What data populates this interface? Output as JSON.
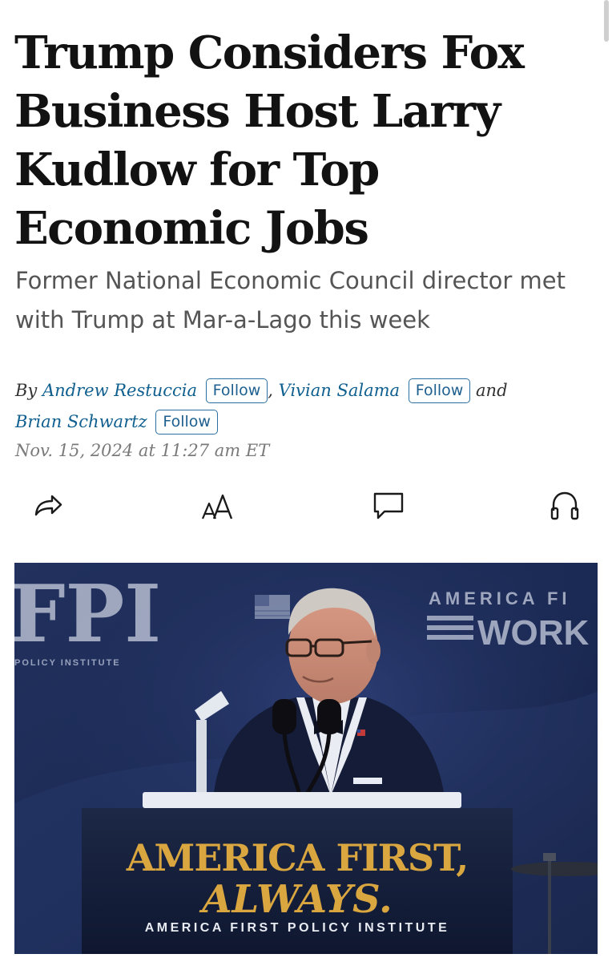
{
  "article": {
    "headline": "Trump Considers Fox Business Host Larry Kudlow for Top Economic Jobs",
    "dek": "Former National Economic Council director met with Trump at Mar-a-Lago this week",
    "byline": {
      "prefix": "By",
      "authors": [
        {
          "name": "Andrew Restuccia",
          "follow_label": "Follow"
        },
        {
          "name": "Vivian Salama",
          "follow_label": "Follow"
        },
        {
          "name": "Brian Schwartz",
          "follow_label": "Follow"
        }
      ],
      "separator": ",",
      "conjunction": "and"
    },
    "timestamp": "Nov. 15, 2024 at 11:27 am ET"
  },
  "toolbar": {
    "items": [
      {
        "icon": "share-icon"
      },
      {
        "icon": "text-size-icon"
      },
      {
        "icon": "comment-icon"
      },
      {
        "icon": "headphones-icon"
      }
    ]
  },
  "photo": {
    "backdrop_left_logo": "FPI",
    "backdrop_left_small": "POLICY INSTITUTE",
    "backdrop_right_top": "AMERICA FI",
    "backdrop_right_big": "WORK",
    "podium_line1": "AMERICA FIRST,",
    "podium_line2": "ALWAYS.",
    "podium_line3": "AMERICA FIRST POLICY INSTITUTE"
  },
  "colors": {
    "headline": "#121212",
    "dek": "#555555",
    "author_link": "#0f5f8f",
    "follow_border": "#2a6fa0",
    "timestamp": "#7a7a7a",
    "podium_gold": "#d9a640"
  }
}
